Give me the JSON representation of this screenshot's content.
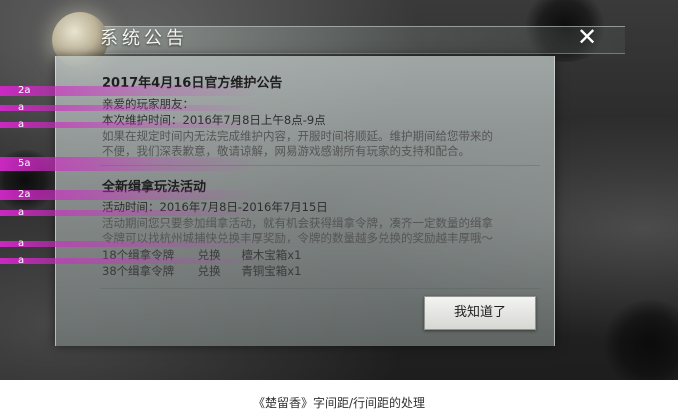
{
  "dialog": {
    "title": "系统公告",
    "close_label": "✕",
    "ok_label": "我知道了"
  },
  "sections": [
    {
      "heading": "2017年4月16日官方维护公告",
      "greeting": "亲爱的玩家朋友：",
      "time": "本次维护时间：2016年7月8日上午8点-9点",
      "body_lines": [
        "如果在规定时间内无法完成维护内容，开服时间将顺延。维护期间给您带来的",
        "不便，我们深表歉意，敬请谅解，网易游戏感谢所有玩家的支持和配合。"
      ]
    },
    {
      "heading": "全新缉拿玩法活动",
      "time": "活动时间：2016年7月8日-2016年7月15日",
      "body_lines": [
        "活动期间您只要参加缉拿活动，就有机会获得缉拿令牌，凑齐一定数量的缉拿",
        "令牌可以找杭州城捕快兑换丰厚奖励，令牌的数量越多兑换的奖励越丰厚哦～"
      ],
      "rewards": [
        {
          "cost": "18个缉拿令牌",
          "action": "兑换",
          "item": "檀木宝箱x1"
        },
        {
          "cost": "38个缉拿令牌",
          "action": "兑换",
          "item": "青铜宝箱x1"
        }
      ]
    }
  ],
  "spacing_markers": [
    "2a",
    "a",
    "a",
    "5a",
    "2a",
    "a",
    "a",
    "a"
  ],
  "caption": "《楚留香》字间距/行间距的处理",
  "colors": {
    "marker": "#d228c8",
    "panel": "#b4bcba",
    "title_text": "#f4f4f0"
  }
}
